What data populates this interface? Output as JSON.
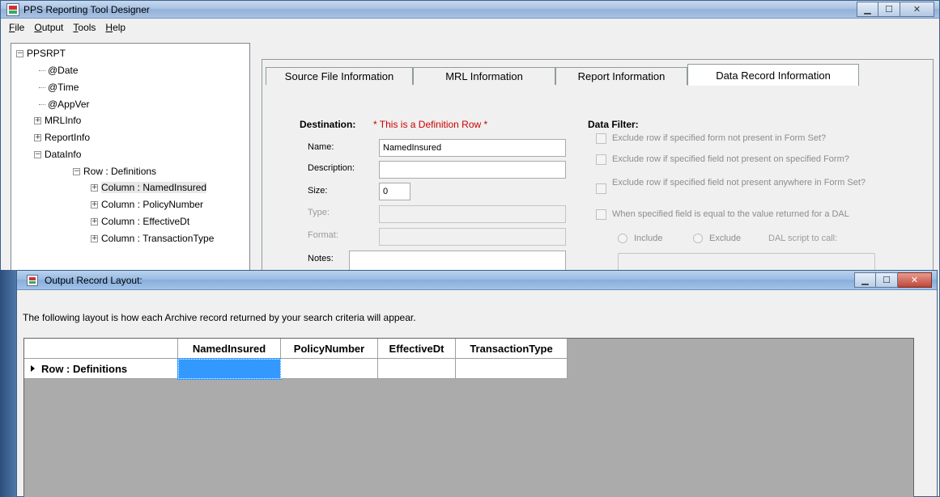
{
  "main_window": {
    "title": "PPS Reporting Tool Designer",
    "menu": [
      {
        "pre": "",
        "u": "F",
        "post": "ile"
      },
      {
        "pre": "",
        "u": "O",
        "post": "utput"
      },
      {
        "pre": "",
        "u": "T",
        "post": "ools"
      },
      {
        "pre": "",
        "u": "H",
        "post": "elp"
      }
    ]
  },
  "tree": {
    "root": "PPSRPT",
    "date": "@Date",
    "time": "@Time",
    "appver": "@AppVer",
    "mrlinfo": "MRLInfo",
    "reportinfo": "ReportInfo",
    "datainfo": "DataInfo",
    "row": "Row : Definitions",
    "col1": "Column : NamedInsured",
    "col2": "Column : PolicyNumber",
    "col3": "Column : EffectiveDt",
    "col4": "Column : TransactionType",
    "expand_glyph": "+",
    "collapse_glyph": "−"
  },
  "tabs": {
    "source": "Source File Information",
    "mrl": "MRL Information",
    "report": "Report Information",
    "data_record": "Data Record Information"
  },
  "destination": {
    "label": "Destination:",
    "note": "* This is a Definition Row *",
    "name_label": "Name:",
    "name_value": "NamedInsured",
    "description_label": "Description:",
    "description_value": "",
    "size_label": "Size:",
    "size_value": "0",
    "type_label": "Type:",
    "format_label": "Format:",
    "notes_label": "Notes:"
  },
  "data_filter": {
    "label": "Data Filter:",
    "opt1": "Exclude row if specified form not present in Form Set?",
    "opt2": "Exclude row if specified field not present on specified Form?",
    "opt3": "Exclude row if specified field not present anywhere in Form Set?",
    "opt4": "When specified field is equal to the value returned for a DAL",
    "include": "Include",
    "exclude": "Exclude",
    "dal_script": "DAL script to call:"
  },
  "output_window": {
    "title": "Output Record Layout:",
    "description": "The following layout is how each Archive record returned by your search criteria will appear.",
    "columns": [
      "NamedInsured",
      "PolicyNumber",
      "EffectiveDt",
      "TransactionType"
    ],
    "row_header": "Row : Definitions"
  },
  "colors": {
    "definition_note": "#cc0000",
    "selected_cell": "#3399ff",
    "grid_background": "#ababab"
  }
}
